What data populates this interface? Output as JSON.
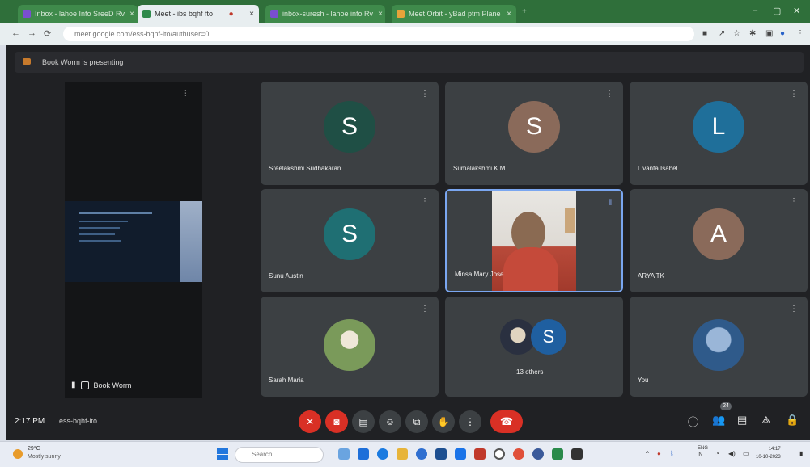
{
  "browser": {
    "tabs": [
      {
        "label": "Inbox - lahoe Info SreeD Rv",
        "color": "#7a4fd0",
        "active": false
      },
      {
        "label": "Meet - ibs bqhf fto",
        "color": "#2f8a4b",
        "active": true
      },
      {
        "label": "inbox-suresh - lahoe info Rv",
        "color": "#7a4fd0",
        "active": false
      },
      {
        "label": "Meet Orbit - yBad ptm Plane",
        "color": "#e8a33a",
        "active": false
      }
    ],
    "new_tab_icon": "plus-icon",
    "url": "meet.google.com/ess-bqhf-ito/authuser=0"
  },
  "meet": {
    "banner": "Book Worm is presenting",
    "presenter_name": "Book Worm",
    "tiles": [
      {
        "name": "Sreelakshmi Sudhakaran",
        "initial": "S",
        "color": "#1f4f45"
      },
      {
        "name": "Sumalakshmi K M",
        "initial": "S",
        "color": "#8a6a5a"
      },
      {
        "name": "Livanta Isabel",
        "initial": "L",
        "color": "#1f6f9a"
      },
      {
        "name": "Sunu Austin",
        "initial": "S",
        "color": "#1f6f73"
      },
      {
        "name": "Minsa Mary Jose",
        "initial": "",
        "color": "#c0392b"
      },
      {
        "name": "ARYA TK",
        "initial": "A",
        "color": "#8a6a5a"
      },
      {
        "name": "Sarah Maria",
        "initial": "",
        "color": "#6a8a4a"
      },
      {
        "name": "13 others",
        "initial": "S",
        "color": "#1f5fa0"
      },
      {
        "name": "You",
        "initial": "",
        "color": "#3a6aa5"
      }
    ],
    "clock": "2:17 PM",
    "meeting_code": "ess-bqhf-ito",
    "people_count": "24",
    "controls": [
      "mic-off-icon",
      "camera-off-icon",
      "captions-icon",
      "emoji-icon",
      "present-icon",
      "raise-hand-icon",
      "more-options-icon"
    ],
    "leave_icon": "call-end-icon"
  },
  "taskbar": {
    "weather_temp": "29°C",
    "weather_condition": "Mostly sunny",
    "search_placeholder": "Search",
    "language": "ENG",
    "language_region": "IN",
    "time": "14:17",
    "date": "10-10-2023"
  }
}
